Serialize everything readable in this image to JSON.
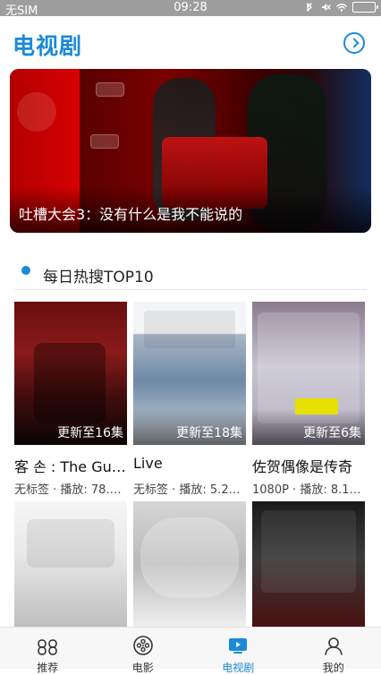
{
  "status_bar": {
    "carrier": "无SIM",
    "time": "09:28"
  },
  "header": {
    "title": "电视剧"
  },
  "banner": {
    "caption": "吐槽大会3：没有什么是我不能说的"
  },
  "section": {
    "title": "每日热搜TOP10"
  },
  "items": [
    {
      "title": "客 손 : The Gu…",
      "meta": "无标签 · 播放: 78.…",
      "badge": "更新至16集"
    },
    {
      "title": "Live",
      "meta": "无标签 · 播放: 5.2…",
      "badge": "更新至18集"
    },
    {
      "title": "佐贺偶像是传奇",
      "meta": "1080P · 播放: 8.1…",
      "badge": "更新至6集"
    }
  ],
  "tabbar": {
    "tabs": [
      {
        "label": "推荐",
        "icon": "grid-icon",
        "active": false
      },
      {
        "label": "电影",
        "icon": "film-reel-icon",
        "active": false
      },
      {
        "label": "电视剧",
        "icon": "tv-icon",
        "active": true
      },
      {
        "label": "我的",
        "icon": "user-icon",
        "active": false
      }
    ]
  },
  "colors": {
    "accent": "#1a8ad8",
    "status_bar_bg": "#9e9e9e"
  }
}
